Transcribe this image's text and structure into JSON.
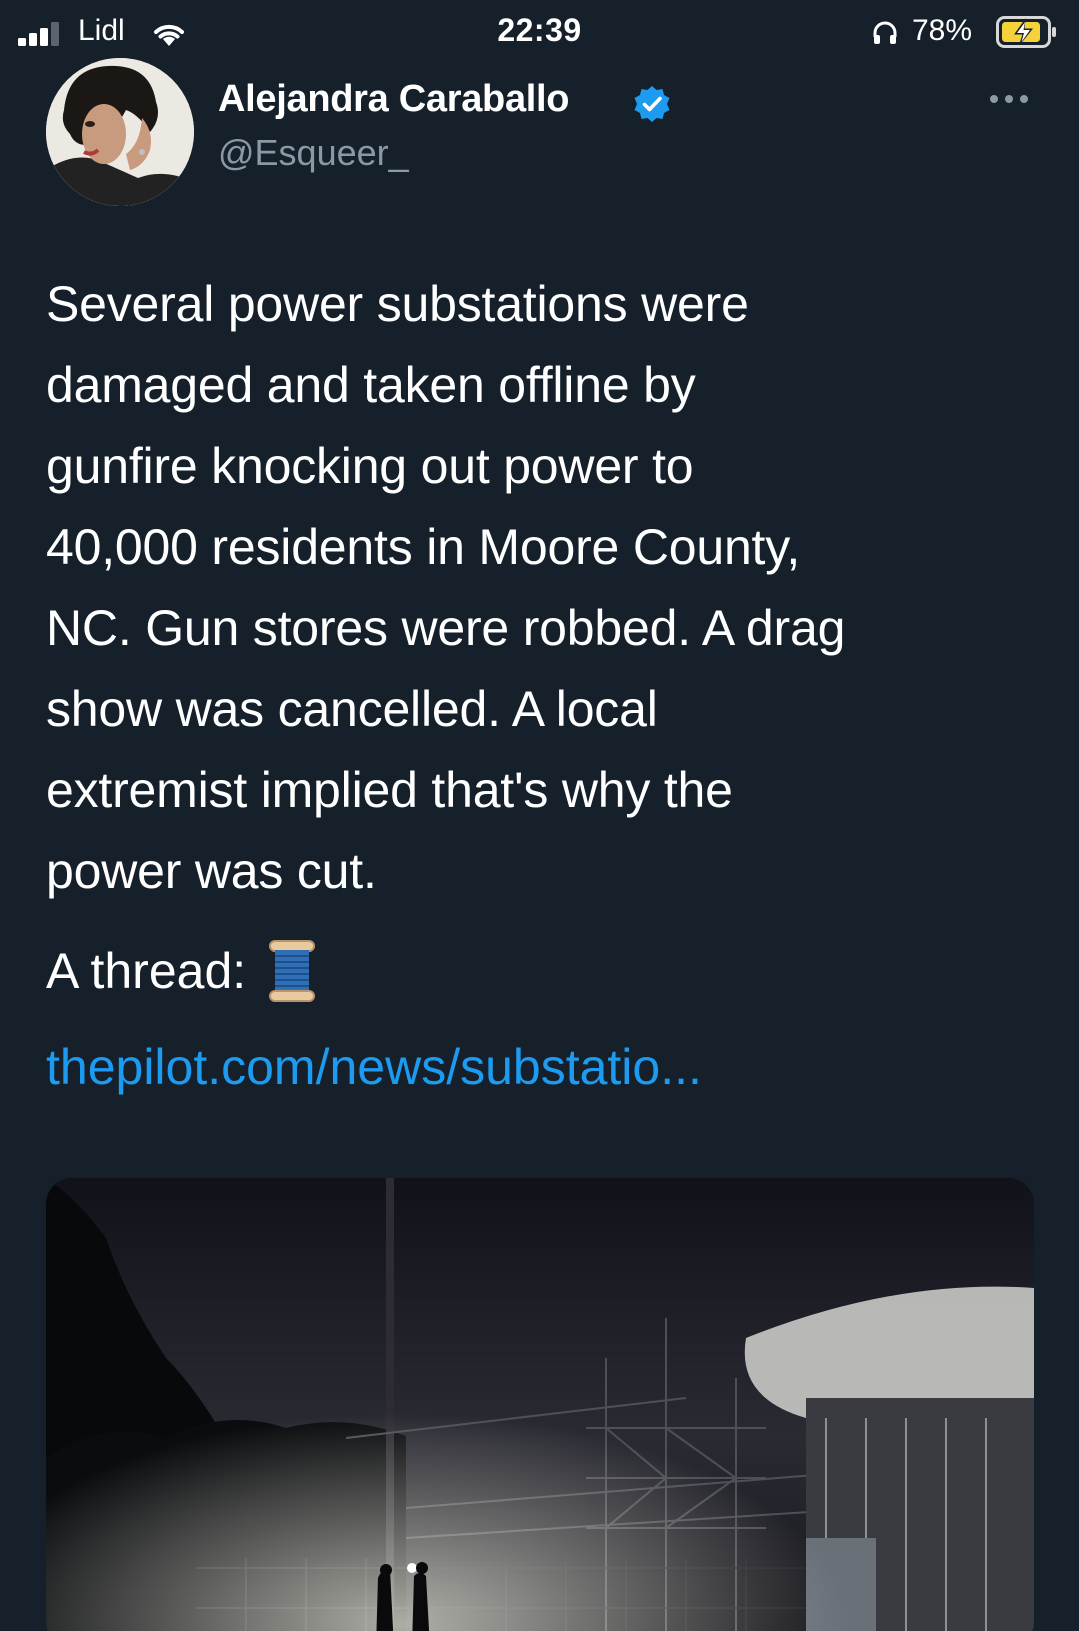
{
  "status_bar": {
    "carrier": "Lidl",
    "time": "22:39",
    "battery_percent": "78%",
    "icons": [
      "signal-icon",
      "wifi-icon",
      "headphones-icon",
      "battery-charging-icon"
    ]
  },
  "tweet": {
    "author_name": "Alejandra Caraballo",
    "handle": "@Esqueer_",
    "verified": true,
    "text": "Several power substations were\ndamaged and taken offline by\ngunfire knocking out power to\n40,000 residents in Moore County,\nNC. Gun stores were robbed. A drag\nshow was cancelled. A local\nextremist implied that's why the\npower was cut.",
    "thread_label": "A thread:",
    "thread_emoji_icon": "spool-of-thread-icon",
    "link_text": "thepilot.com/news/substatio..."
  },
  "colors": {
    "background": "#15202b",
    "text": "#ffffff",
    "secondary_text": "#8b98a5",
    "link": "#1d9bf0",
    "verified_badge": "#1d9bf0"
  }
}
